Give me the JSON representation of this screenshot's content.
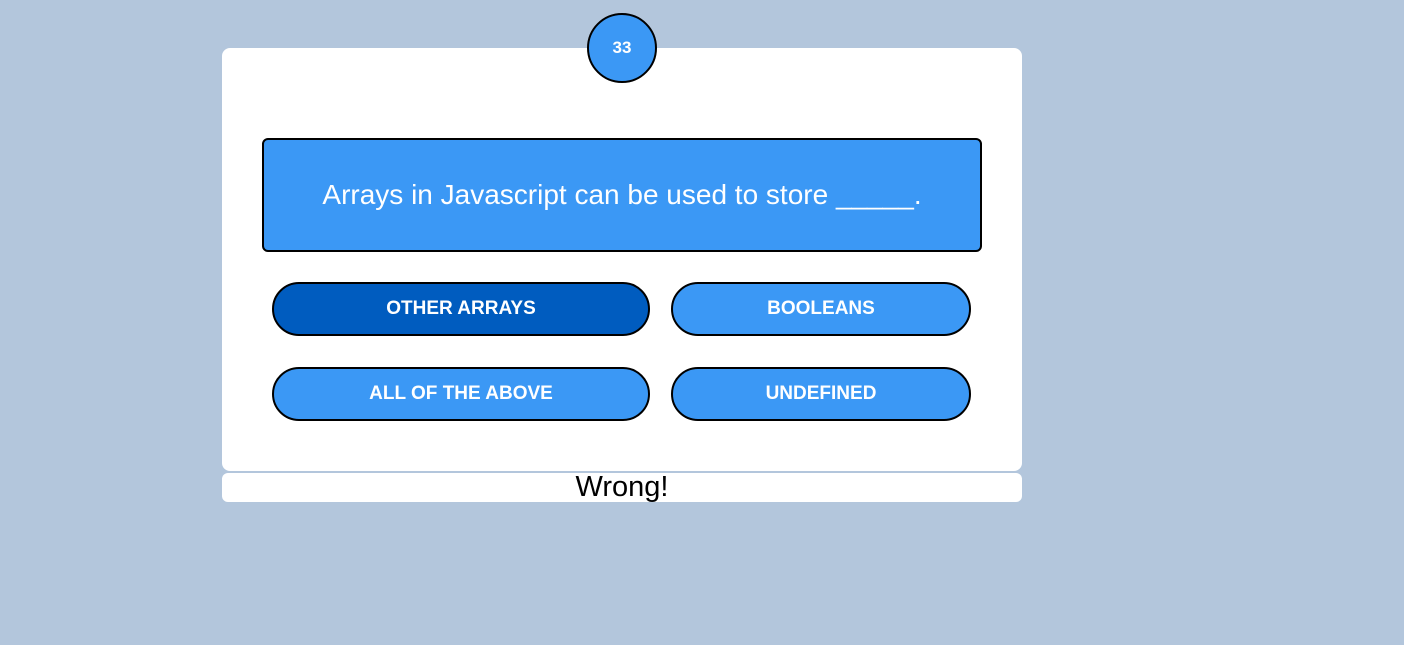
{
  "timer": {
    "value": "33"
  },
  "question": {
    "text": "Arrays in Javascript can be used to store _____."
  },
  "answers": [
    {
      "label": "OTHER ARRAYS",
      "selected": true
    },
    {
      "label": "BOOLEANS",
      "selected": false
    },
    {
      "label": "ALL OF THE ABOVE",
      "selected": false
    },
    {
      "label": "UNDEFINED",
      "selected": false
    }
  ],
  "feedback": {
    "text": "Wrong!"
  },
  "colors": {
    "background": "#b3c6dc",
    "accent": "#3b98f5",
    "selected": "#005cbf"
  }
}
